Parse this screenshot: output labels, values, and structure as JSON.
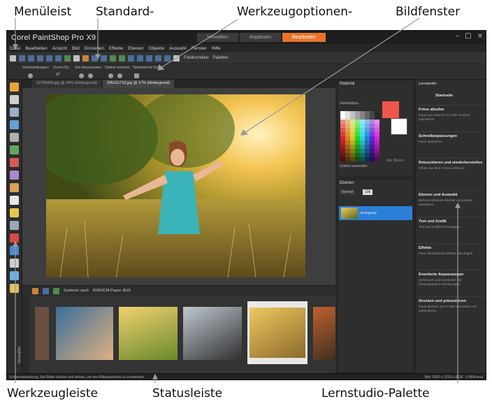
{
  "callouts": {
    "menu_bar": "Menüleist",
    "standard": "Standard-",
    "tool_options": "Werkzeugoptionen-",
    "image_window": "Bildfenster",
    "toolbar": "Werkzeugleiste",
    "status_bar": "Statusleiste",
    "learning_palette": "Lernstudio-Palette"
  },
  "app": {
    "title": "Corel PaintShop Pro X9",
    "modes": [
      "Verwalten",
      "Anpassen",
      "Bearbeiten"
    ],
    "active_mode": "Bearbeiten",
    "window_controls": [
      "–",
      "□",
      "×"
    ]
  },
  "menu": [
    "Datei",
    "Bearbeiten",
    "Ansicht",
    "Bild",
    "Einstellen",
    "Effekte",
    "Ebenen",
    "Objekte",
    "Auswahl",
    "Fenster",
    "Hilfe"
  ],
  "standard_toolbar": {
    "photo_fix": "Fotokorrektur",
    "palettes": "Paletten"
  },
  "tool_options": {
    "presets": "Voreinstellungen:",
    "zoom": "Zoom (%):",
    "zoom_value": "17",
    "zoom_inout": "Ein-/Auszoomen:",
    "step_zoom": "Stärker zoomen:",
    "actual_size": "Tatsächliche Größe:"
  },
  "document_tabs": [
    {
      "label": "22709399.jpg @ 24% (Hintergrund)",
      "active": false
    },
    {
      "label": "205161716.jpg @ 17% (Hintergrund)",
      "active": true
    }
  ],
  "organizer": {
    "sort": "Sortieren nach",
    "color_info": "RGB/ICM-Paare: AUS",
    "side_label": "Verwalter"
  },
  "material": {
    "title": "Material",
    "preset_label": "Standardpa...",
    "recent": "Zuletzt verwendet",
    "all_recent": "Alle Bildern"
  },
  "layers": {
    "title": "Ebenen",
    "blend_mode": "Normal",
    "opacity": "100",
    "layer_name": "Hintergrund"
  },
  "learn": {
    "title": "Lernstudio",
    "home": "Startseite",
    "items": [
      {
        "h": "Fotos abrufen",
        "d": "Fotos aus Kamera, PC oder Scanner importieren."
      },
      {
        "h": "Schnellanpassungen",
        "d": "Fotos optimieren."
      },
      {
        "h": "Retuschieren und wiederherstellen",
        "d": "Fehler aus Ihren Fotos entfernen."
      },
      {
        "h": "Ebenen und Auswahl",
        "d": "Mehrere Elemente flexibel und präzise bearbeiten."
      },
      {
        "h": "Text und Grafik",
        "d": "Text und Grafiken hinzufügen."
      },
      {
        "h": "Effekte",
        "d": "Fotos künstlerische Effekte hinzufügen."
      },
      {
        "h": "Erweiterte Anpassungen",
        "d": "Verbessern und bearbeiten mit leistungsstarken Werkzeugen."
      },
      {
        "h": "Drucken und präsentieren",
        "d": "Fotos drucken, per E-Mail versenden und präsentieren."
      }
    ]
  },
  "status": {
    "text": "Schwenkwerkzeug: Auf Bilder klicken und ziehen, um den Bildausschnitt zu schwenken.",
    "info": "Bild: 5000 x 3333 x RGB - 8 Bit/Kanal"
  },
  "colors": {
    "accent": "#e8742a",
    "selection": "#2b7fd8",
    "foreground": "#f0564a",
    "background": "#ffffff"
  }
}
